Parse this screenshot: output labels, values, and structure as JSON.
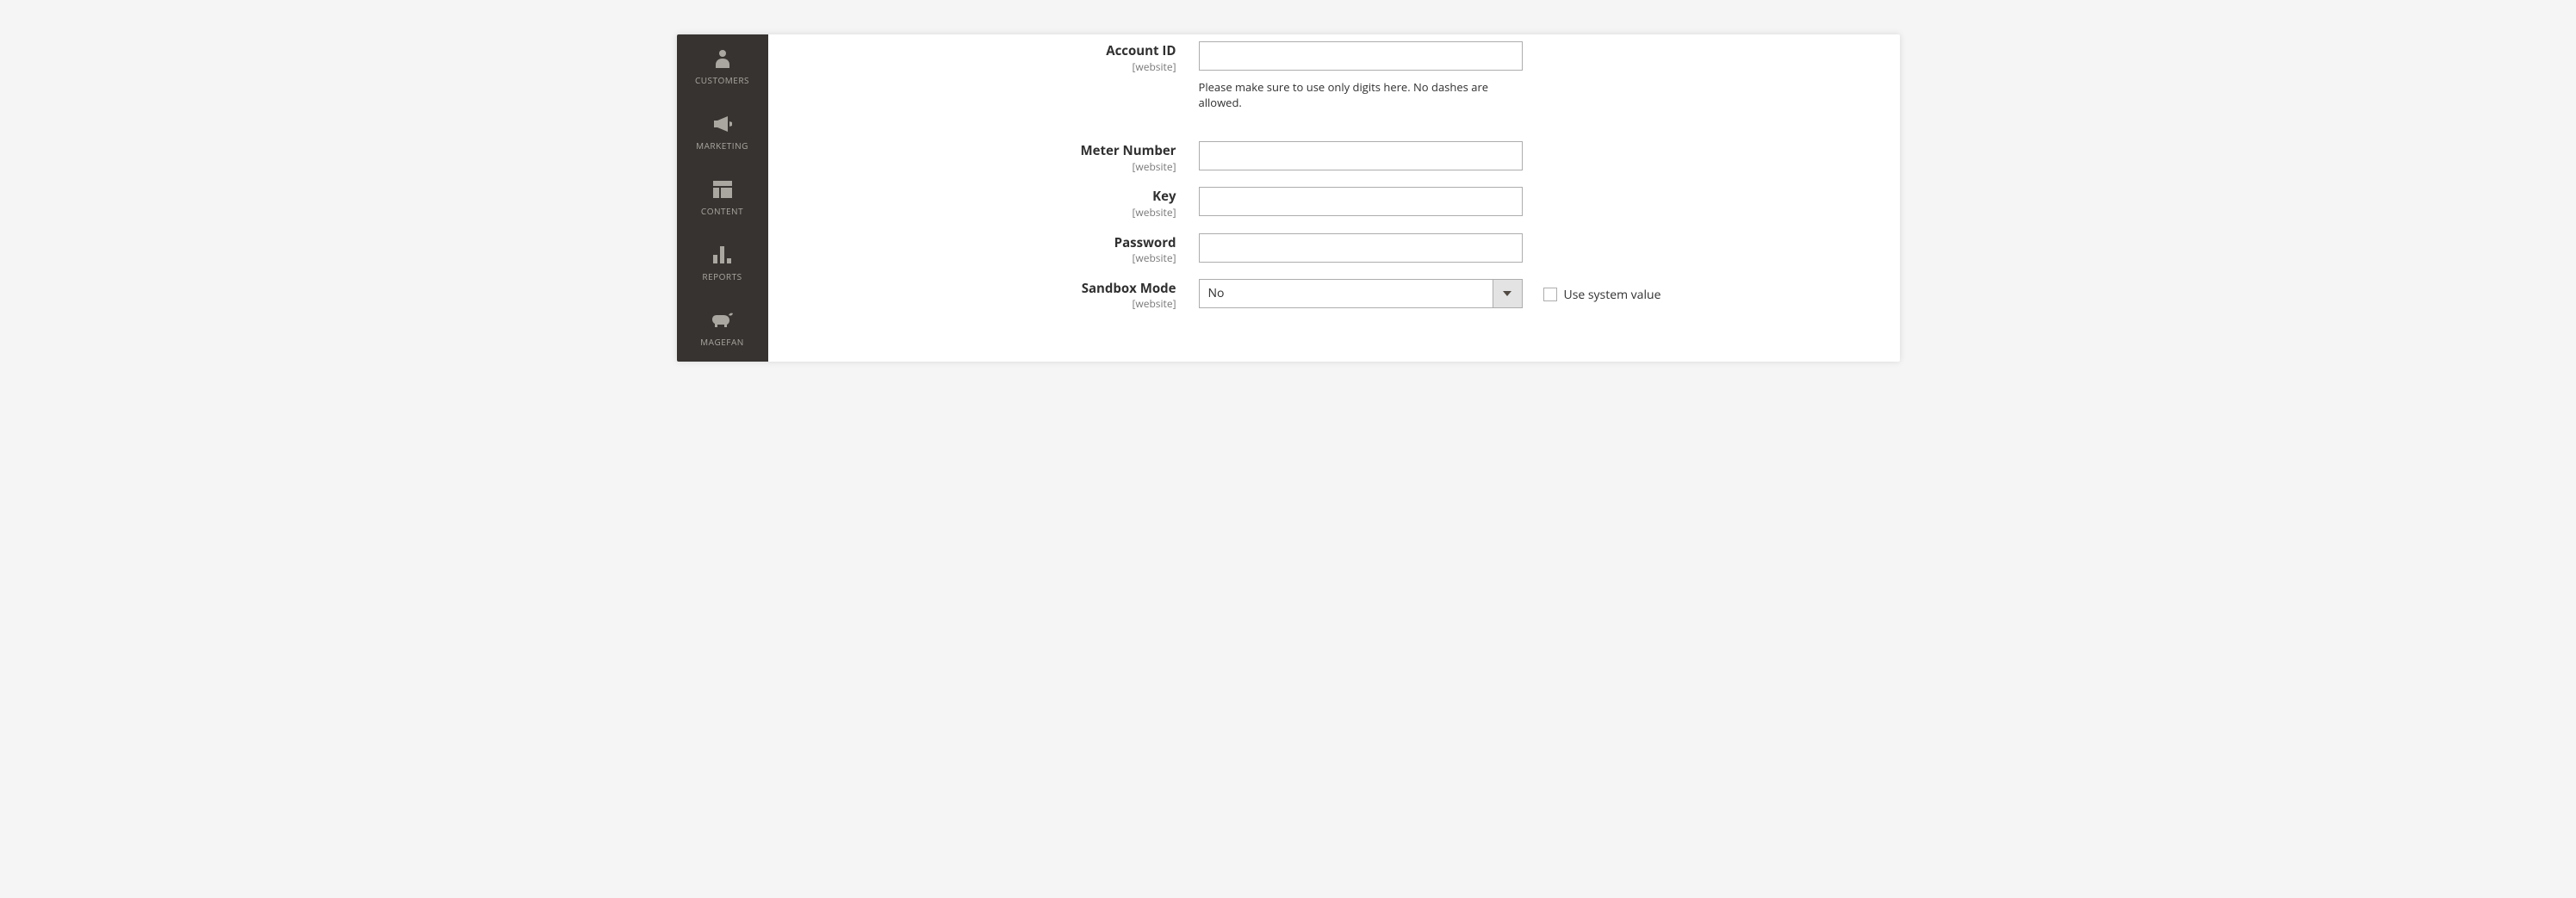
{
  "sidebar": {
    "items": [
      {
        "label": "CUSTOMERS"
      },
      {
        "label": "MARKETING"
      },
      {
        "label": "CONTENT"
      },
      {
        "label": "REPORTS"
      },
      {
        "label": "MAGEFAN"
      }
    ]
  },
  "form": {
    "scope_text": "[website]",
    "account_id": {
      "label": "Account ID",
      "value": "",
      "note": "Please make sure to use only digits here. No dashes are allowed."
    },
    "meter_number": {
      "label": "Meter Number",
      "value": ""
    },
    "key": {
      "label": "Key",
      "value": ""
    },
    "password": {
      "label": "Password",
      "value": ""
    },
    "sandbox_mode": {
      "label": "Sandbox Mode",
      "value": "No",
      "use_system_label": "Use system value",
      "use_system_checked": false
    }
  }
}
